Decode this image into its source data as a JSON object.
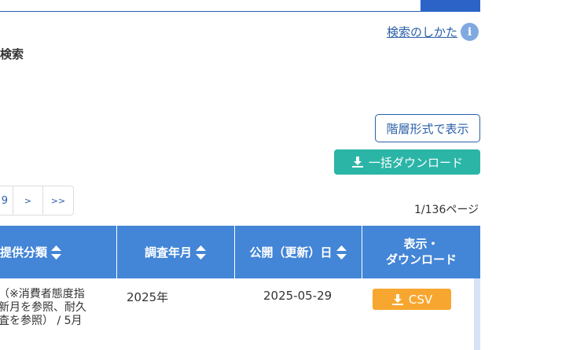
{
  "help": {
    "label": "検索のしかた",
    "icon": "info-icon"
  },
  "section": {
    "title": "検索"
  },
  "actions": {
    "hierarchy_label": "階層形式で表示",
    "bulk_download_label": "一括ダウンロード",
    "bulk_download_color": "#2bb5a7"
  },
  "pagination": {
    "items": [
      "9",
      ">",
      ">>"
    ],
    "page_count": "1/136ページ"
  },
  "table": {
    "header_color": "#4385d6",
    "headers": [
      "提供分類",
      "調査年月",
      "公開（更新）日",
      "表示・",
      "ダウンロード"
    ],
    "rows": [
      {
        "desc_lines": [
          "（※消費者態度指",
          "新月を参照、耐久",
          "査を参照） / 5月"
        ],
        "year": "2025年",
        "date": "2025-05-29",
        "download_label": "CSV",
        "download_color": "#f7a72f"
      }
    ]
  }
}
